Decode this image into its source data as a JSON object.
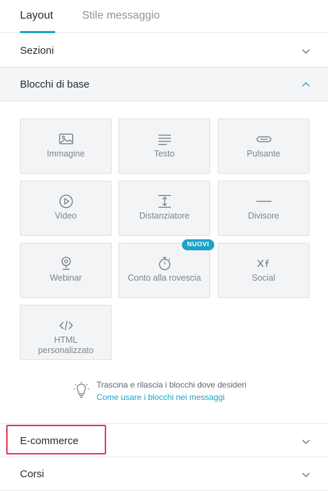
{
  "tabs": [
    {
      "label": "Layout",
      "active": true
    },
    {
      "label": "Stile messaggio",
      "active": false
    }
  ],
  "sections": {
    "sezioni": {
      "label": "Sezioni"
    },
    "blocchi_base": {
      "label": "Blocchi di base"
    },
    "ecommerce": {
      "label": "E-commerce"
    },
    "corsi": {
      "label": "Corsi"
    }
  },
  "blocks": [
    {
      "label": "Immagine",
      "icon": "image-icon"
    },
    {
      "label": "Testo",
      "icon": "text-icon"
    },
    {
      "label": "Pulsante",
      "icon": "button-icon"
    },
    {
      "label": "Video",
      "icon": "play-icon"
    },
    {
      "label": "Distanziatore",
      "icon": "spacer-icon"
    },
    {
      "label": "Divisore",
      "icon": "divider-icon"
    },
    {
      "label": "Webinar",
      "icon": "webcam-icon"
    },
    {
      "label": "Conto alla rovescia",
      "icon": "stopwatch-icon"
    },
    {
      "label": "Social",
      "icon": "social-icon"
    },
    {
      "label": "HTML personalizzato",
      "icon": "code-icon"
    }
  ],
  "badge": {
    "label": "NUOVI"
  },
  "tip": {
    "text": "Trascina e rilascia i blocchi dove desideri",
    "link": "Come usare i blocchi nei messaggi",
    "icon": "lightbulb-icon"
  },
  "colors": {
    "accent": "#1ba3c7",
    "highlight": "#e5334d"
  }
}
